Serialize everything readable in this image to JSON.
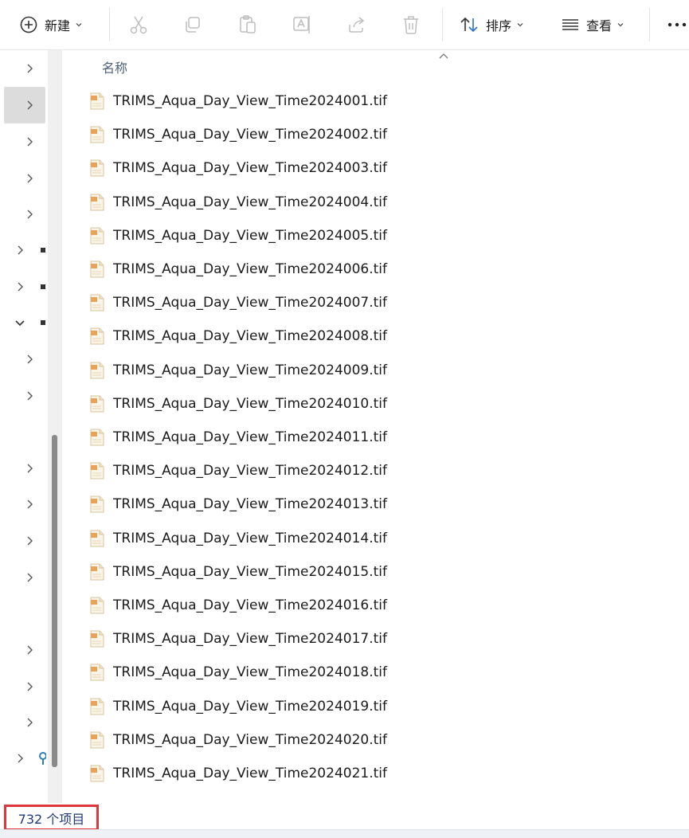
{
  "toolbar": {
    "new_label": "新建",
    "sort_label": "排序",
    "view_label": "查看"
  },
  "icons": {
    "new": "plus-circle-icon",
    "cut": "scissors-icon",
    "copy": "copy-icon",
    "paste": "clipboard-icon",
    "rename": "rename-icon",
    "share": "share-icon",
    "delete": "trash-icon",
    "sort": "sort-arrows-icon",
    "view": "list-lines-icon",
    "more": "more-dots-icon",
    "file": "tif-file-icon"
  },
  "list": {
    "column_name": "名称",
    "files": [
      "TRIMS_Aqua_Day_View_Time2024001.tif",
      "TRIMS_Aqua_Day_View_Time2024002.tif",
      "TRIMS_Aqua_Day_View_Time2024003.tif",
      "TRIMS_Aqua_Day_View_Time2024004.tif",
      "TRIMS_Aqua_Day_View_Time2024005.tif",
      "TRIMS_Aqua_Day_View_Time2024006.tif",
      "TRIMS_Aqua_Day_View_Time2024007.tif",
      "TRIMS_Aqua_Day_View_Time2024008.tif",
      "TRIMS_Aqua_Day_View_Time2024009.tif",
      "TRIMS_Aqua_Day_View_Time2024010.tif",
      "TRIMS_Aqua_Day_View_Time2024011.tif",
      "TRIMS_Aqua_Day_View_Time2024012.tif",
      "TRIMS_Aqua_Day_View_Time2024013.tif",
      "TRIMS_Aqua_Day_View_Time2024014.tif",
      "TRIMS_Aqua_Day_View_Time2024015.tif",
      "TRIMS_Aqua_Day_View_Time2024016.tif",
      "TRIMS_Aqua_Day_View_Time2024017.tif",
      "TRIMS_Aqua_Day_View_Time2024018.tif",
      "TRIMS_Aqua_Day_View_Time2024019.tif",
      "TRIMS_Aqua_Day_View_Time2024020.tif",
      "TRIMS_Aqua_Day_View_Time2024021.tif"
    ]
  },
  "status": {
    "item_count": "732 个项目"
  },
  "colors": {
    "highlight_border": "#e0353b",
    "status_text": "#1f3a7a",
    "header_text": "#4c607a"
  }
}
